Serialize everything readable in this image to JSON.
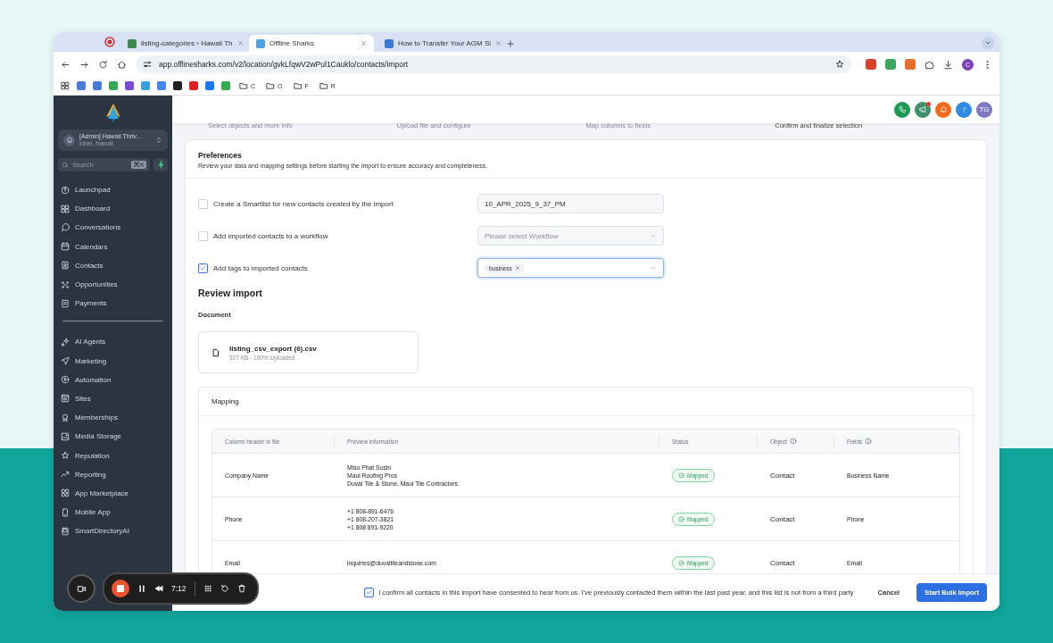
{
  "browser": {
    "tabs": [
      {
        "title": "listing-categories ‹ Hawaii Th",
        "selected": false
      },
      {
        "title": "Offline Sharks",
        "selected": true
      },
      {
        "title": "How to Transfer Your AGM Si",
        "selected": false
      }
    ],
    "url": "app.offlinesharks.com/v2/location/gvkLfqwV2wPul1Cauklo/contacts/import",
    "profile": "C",
    "bookmark_folders": [
      "C",
      "O",
      "F",
      "R"
    ]
  },
  "sidebar": {
    "account": {
      "name": "[Admin] Hawaii Thriv...",
      "location": "kihei, hawaii"
    },
    "search": {
      "placeholder": "Search",
      "shortcut": "⌘K"
    },
    "nav_groups": [
      [
        "Launchpad",
        "Dashboard",
        "Conversations",
        "Calendars",
        "Contacts",
        "Opportunities",
        "Payments"
      ],
      [
        "AI Agents",
        "Marketing",
        "Automation",
        "Sites",
        "Memberships",
        "Media Storage",
        "Reputation",
        "Reporting",
        "App Marketplace",
        "Mobile App",
        "SmartDirectoryAI"
      ]
    ]
  },
  "header": {
    "avatar": "TG"
  },
  "steps": [
    {
      "label": "Select objects and more info",
      "selected": false
    },
    {
      "label": "Upload file and configure",
      "selected": false
    },
    {
      "label": "Map columns to fields",
      "selected": false
    },
    {
      "label": "Confirm and finalize selection",
      "selected": true
    }
  ],
  "preferences": {
    "title": "Preferences",
    "description": "Review your data and mapping settings before starting the import to ensure accuracy and completeness.",
    "options": [
      {
        "kind": "text",
        "label": "Create a Smartlist for new contacts created by the import",
        "checked": false,
        "focused": false,
        "value": "10_APR_2025_9_37_PM"
      },
      {
        "kind": "select",
        "label": "Add imported contacts to a workflow",
        "checked": false,
        "focused": false,
        "placeholder": "Please select Workflow"
      },
      {
        "kind": "tags",
        "label": "Add tags to imported contacts",
        "checked": true,
        "focused": true,
        "tags": [
          "business"
        ]
      }
    ]
  },
  "review": {
    "title": "Review import",
    "document_label": "Document",
    "file": {
      "name": "listing_csv_export (6).csv",
      "meta": "927 KB - 100% Uploaded"
    }
  },
  "mapping": {
    "title": "Mapping",
    "columns": [
      {
        "label": "Column header in file",
        "info": false
      },
      {
        "label": "Preview information",
        "info": false
      },
      {
        "label": "Status",
        "info": false
      },
      {
        "label": "Object",
        "info": true
      },
      {
        "label": "Fields",
        "info": true
      }
    ],
    "rows": [
      {
        "column": "Company Name",
        "preview": [
          "Miso Phat Sushi",
          "Maui Roofing Pros",
          "Duval Tile & Stone, Maui Tile Contractors"
        ],
        "status": "Mapped",
        "object": "Contact",
        "field": "Business Name"
      },
      {
        "column": "Phone",
        "preview": [
          "+1 808-891-6476",
          "+1 808-207-3821",
          "+1 808 891-9220"
        ],
        "status": "Mapped",
        "object": "Contact",
        "field": "Phone"
      },
      {
        "column": "Email",
        "preview": [
          "inquiries@duvaltileandstone.com"
        ],
        "status": "Mapped",
        "object": "Contact",
        "field": "Email"
      }
    ]
  },
  "footer": {
    "consent": {
      "checked": true,
      "text": "I confirm all contacts in this import have consented to hear from us. I've previously contacted them within the last past year, and this list is not from a third party"
    },
    "buttons": [
      {
        "kind": "secondary",
        "label": "Cancel"
      },
      {
        "kind": "primary",
        "label": "Start Bulk Import"
      }
    ]
  },
  "recorder": {
    "time": "7:12"
  }
}
